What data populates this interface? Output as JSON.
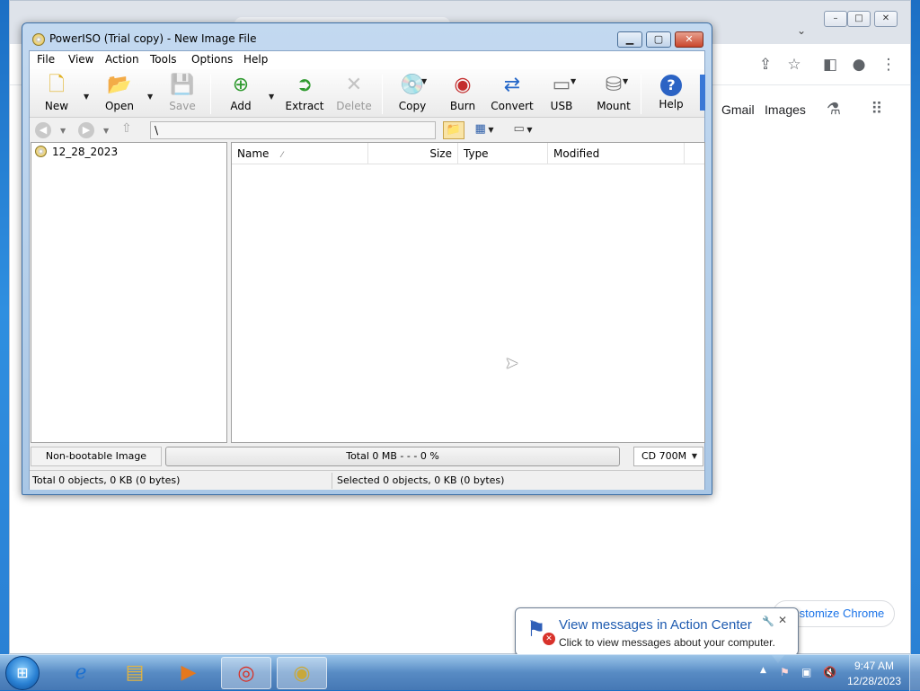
{
  "chrome": {
    "links": {
      "gmail": "Gmail",
      "images": "Images"
    },
    "customize_label": "Customize Chrome",
    "icons": [
      "share-icon",
      "star-icon",
      "side-panel-icon",
      "profile-icon",
      "more-vert-icon",
      "labs-icon",
      "apps-grid-icon"
    ]
  },
  "poweriso": {
    "title": "PowerISO (Trial copy) - New Image File",
    "menu": [
      "File",
      "View",
      "Action",
      "Tools",
      "Options",
      "Help"
    ],
    "toolbar": {
      "new": "New",
      "open": "Open",
      "save": "Save",
      "add": "Add",
      "extract": "Extract",
      "delete": "Delete",
      "copy": "Copy",
      "burn": "Burn",
      "convert": "Convert",
      "usb": "USB",
      "mount": "Mount",
      "help": "Help"
    },
    "path": "\\",
    "tree": {
      "root": "12_28_2023"
    },
    "columns": {
      "name": "Name",
      "size": "Size",
      "type": "Type",
      "modified": "Modified"
    },
    "status": {
      "boot": "Non-bootable Image",
      "total_progress": "Total  0 MB   - - -  0 %",
      "media": "CD 700M",
      "total_objects": "Total 0 objects, 0 KB (0 bytes)",
      "selected_objects": "Selected 0 objects, 0 KB (0 bytes)"
    }
  },
  "balloon": {
    "title": "View messages in Action Center",
    "body": "Click to view messages about your computer."
  },
  "taskbar": {
    "time": "9:47 AM",
    "date": "12/28/2023"
  },
  "colors": {
    "accent": "#1e5bb0",
    "link": "#1a73e8",
    "desktop": "#2a7fd3"
  }
}
